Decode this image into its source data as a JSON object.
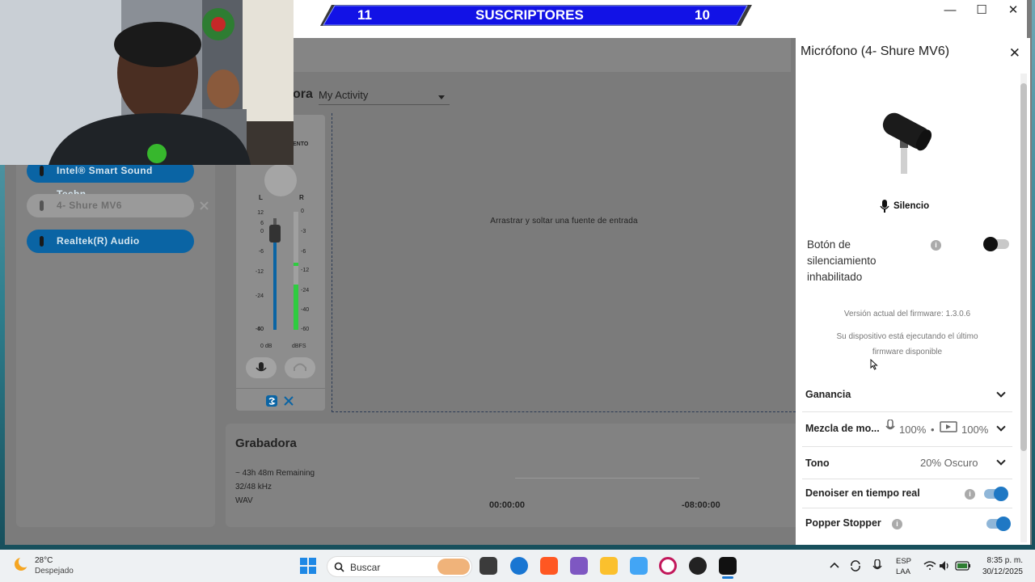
{
  "banner": {
    "left_number": "11",
    "title": "SUSCRIPTORES",
    "right_number": "10"
  },
  "window": {
    "minimize": "—",
    "maximize": "☐",
    "close": "✕"
  },
  "devices": [
    {
      "label": "Intel® Smart Sound Techn..."
    },
    {
      "label": "4- Shure MV6"
    },
    {
      "label": "Realtek(R) Audio"
    }
  ],
  "activity": {
    "title_fragment": "ora",
    "dropdown_value": "My Activity"
  },
  "mixer": {
    "header_fragment": "ENTO",
    "l_label": "L",
    "r_label": "R",
    "left_ticks": [
      "12",
      "6",
      "0",
      "-6",
      "-12",
      "-24",
      "-40",
      "-60"
    ],
    "right_ticks": [
      "0",
      "-3",
      "-6",
      "-12",
      "-24",
      "-40",
      "-60"
    ],
    "gain_label": "0 dB",
    "dbfs_label": "dBFS"
  },
  "dropzone": {
    "text": "Arrastrar y soltar una fuente de entrada"
  },
  "recorder": {
    "title": "Grabadora",
    "remaining": "~ 43h 48m Remaining",
    "rate": "32/48 kHz",
    "format": "WAV",
    "time_elapsed": "00:00:00",
    "time_remaining": "-08:00:00"
  },
  "side_panel": {
    "title": "Micrófono (4- Shure MV6)",
    "close": "✕",
    "mute_label": "Silencio",
    "mute_button_setting": "Botón de silenciamiento inhabilitado",
    "firmware_version": "Versión actual del firmware: 1.3.0.6",
    "firmware_status": "Su dispositivo está ejecutando el último firmware disponible",
    "gain_label": "Ganancia",
    "mix_label": "Mezcla de mo...",
    "mix_mic_value": "100%",
    "mix_dot": "•",
    "mix_playback_value": "100%",
    "tone_label": "Tono",
    "tone_value": "20% Oscuro",
    "denoiser_label": "Denoiser en tiempo real",
    "popper_label": "Popper Stopper",
    "info_glyph": "i"
  },
  "toggles": {
    "mute_button_enabled": false,
    "denoiser_enabled": true,
    "popper_stopper_enabled": true
  },
  "taskbar": {
    "weather_temp": "28°C",
    "weather_desc": "Despejado",
    "search_placeholder": "Buscar",
    "lang_top": "ESP",
    "lang_bottom": "LAA",
    "time": "8:35 p. m.",
    "date": "30/12/2025"
  },
  "colors": {
    "accent": "#0a64a4",
    "banner": "#1212e6",
    "meter_green": "#2ecc40",
    "toggle_on": "#1f78c4"
  }
}
